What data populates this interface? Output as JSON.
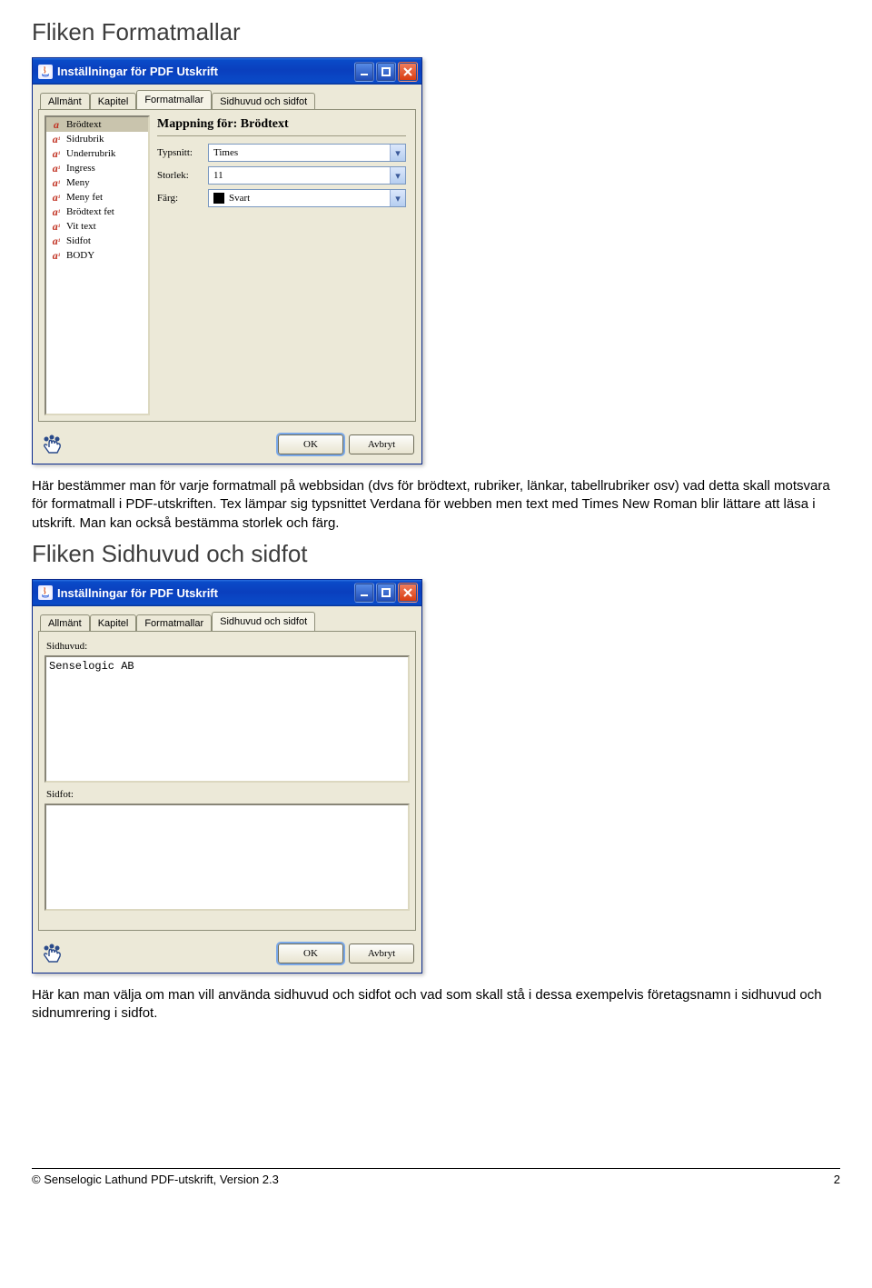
{
  "headings": {
    "section1": "Fliken Formatmallar",
    "section2": "Fliken Sidhuvud och sidfot"
  },
  "paragraphs": {
    "p1": "Här bestämmer man för varje formatmall på webbsidan (dvs för brödtext, rubriker, länkar, tabellrubriker osv) vad detta skall motsvara för formatmall i PDF-utskriften. Tex lämpar sig typsnittet Verdana för webben men text med Times New Roman blir lättare att läsa i utskrift. Man kan också bestämma storlek och färg.",
    "p2": "Här kan man välja om man vill använda sidhuvud och sidfot och vad som skall stå i dessa exempelvis företagsnamn i sidhuvud och sidnumrering i sidfot."
  },
  "dialog": {
    "title": "Inställningar för PDF Utskrift",
    "tabs": {
      "t1": "Allmänt",
      "t2": "Kapitel",
      "t3": "Formatmallar",
      "t4": "Sidhuvud och sidfot"
    },
    "buttons": {
      "ok": "OK",
      "cancel": "Avbryt"
    }
  },
  "formatmallar": {
    "list": [
      "Brödtext",
      "Sidrubrik",
      "Underrubrik",
      "Ingress",
      "Meny",
      "Meny fet",
      "Brödtext fet",
      "Vit text",
      "Sidfot",
      "BODY"
    ],
    "panel_title_prefix": "Mappning för: ",
    "panel_title_value": "Brödtext",
    "labels": {
      "typsnitt": "Typsnitt:",
      "storlek": "Storlek:",
      "farg": "Färg:"
    },
    "values": {
      "typsnitt": "Times",
      "storlek": "11",
      "farg": "Svart"
    }
  },
  "sidhuvud": {
    "label_head": "Sidhuvud:",
    "label_foot": "Sidfot:",
    "head_value": "Senselogic AB",
    "foot_value": ""
  },
  "footer": {
    "left": "© Senselogic Lathund PDF-utskrift, Version 2.3",
    "right": "2"
  }
}
